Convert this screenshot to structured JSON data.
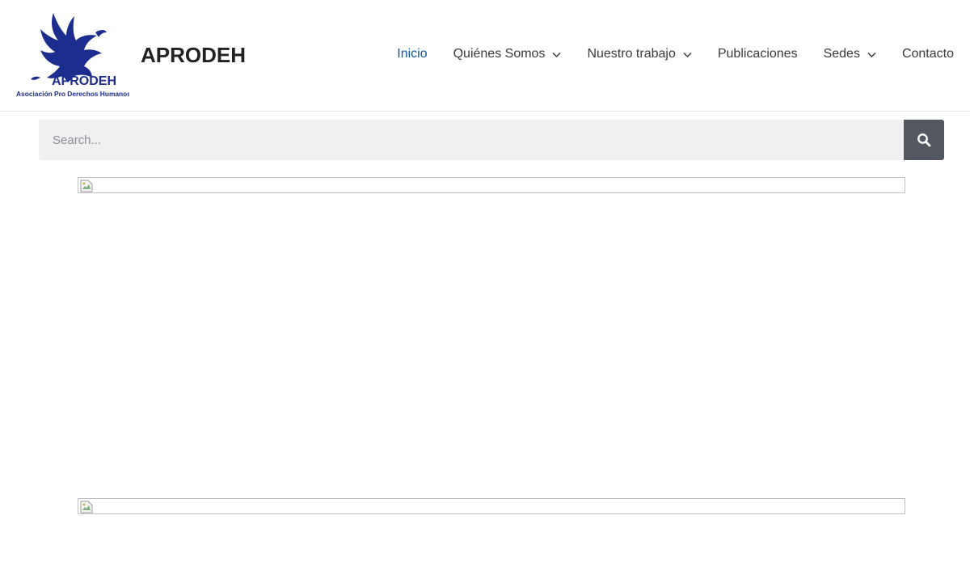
{
  "header": {
    "logo": {
      "wordmark": "APRODEH",
      "tagline": "Asociación Pro Derechos Humanos",
      "color": "#1c2d8f"
    },
    "site_title": "APRODEH",
    "nav": [
      {
        "label": "Inicio",
        "active": true,
        "has_dropdown": false
      },
      {
        "label": "Quiénes Somos",
        "active": false,
        "has_dropdown": true
      },
      {
        "label": "Nuestro trabajo",
        "active": false,
        "has_dropdown": true
      },
      {
        "label": "Publicaciones",
        "active": false,
        "has_dropdown": false
      },
      {
        "label": "Sedes",
        "active": false,
        "has_dropdown": true
      },
      {
        "label": "Contacto",
        "active": false,
        "has_dropdown": false
      }
    ]
  },
  "search": {
    "placeholder": "Search...",
    "value": "",
    "button_icon": "search-icon"
  },
  "content": {
    "images": [
      {
        "state": "broken",
        "icon": "broken-image-icon"
      },
      {
        "state": "broken",
        "icon": "broken-image-icon"
      }
    ]
  },
  "colors": {
    "accent": "#0b57a4",
    "text": "#3a3a3a",
    "search_bg": "#eff0f2",
    "search_button": "#525760"
  }
}
